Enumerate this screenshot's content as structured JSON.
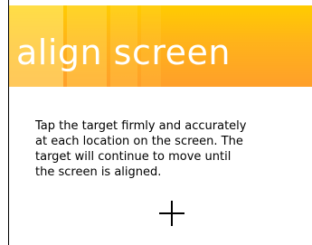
{
  "screen": {
    "title": "align screen",
    "instructions_lines": [
      "Tap the target firmly and accurately",
      "at each location on the screen. The",
      "target will continue to move until",
      "the screen is aligned."
    ]
  },
  "icons": {
    "target": "crosshair-target-icon"
  },
  "colors": {
    "header_top": "#ffcc00",
    "header_bottom": "#ff9f2a",
    "title_text": "#ffffff",
    "body_text": "#000000",
    "background": "#ffffff"
  }
}
